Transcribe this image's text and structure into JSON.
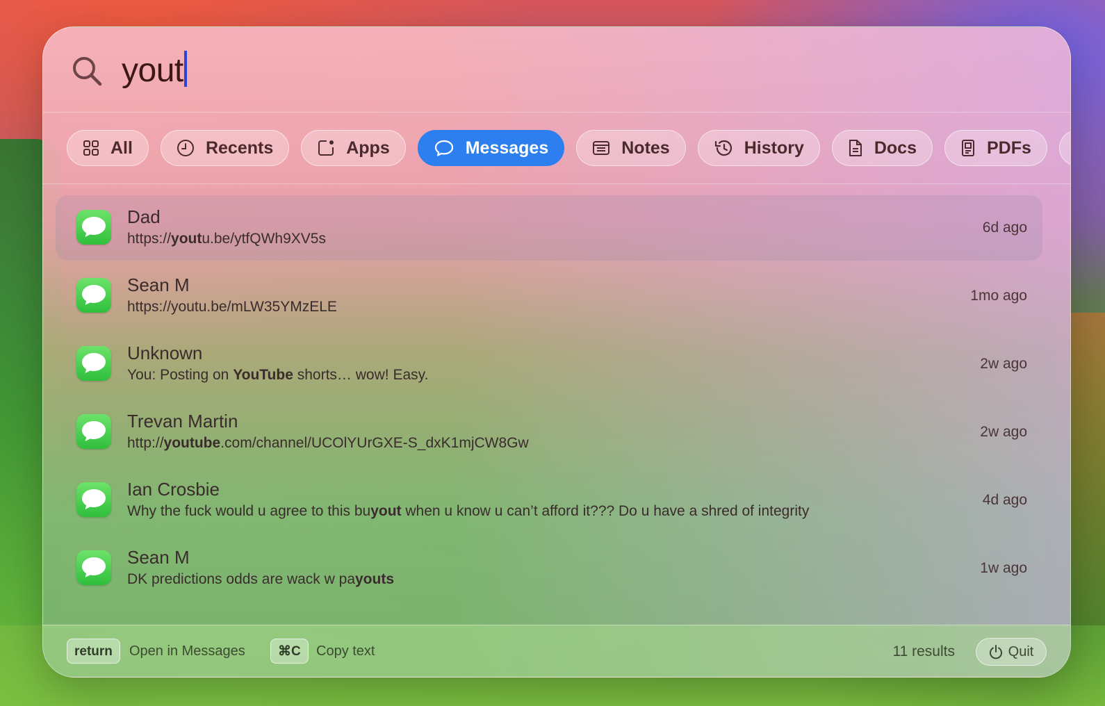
{
  "search": {
    "query": "yout",
    "icon": "search-icon"
  },
  "tabs": [
    {
      "label": "All",
      "icon": "grid-icon",
      "active": false
    },
    {
      "label": "Recents",
      "icon": "clock-icon",
      "active": false
    },
    {
      "label": "Apps",
      "icon": "app-icon",
      "active": false
    },
    {
      "label": "Messages",
      "icon": "speech-bubble-icon",
      "active": true
    },
    {
      "label": "Notes",
      "icon": "note-icon",
      "active": false
    },
    {
      "label": "History",
      "icon": "history-icon",
      "active": false
    },
    {
      "label": "Docs",
      "icon": "document-icon",
      "active": false
    },
    {
      "label": "PDFs",
      "icon": "pdf-icon",
      "active": false
    }
  ],
  "results": [
    {
      "name": "Dad",
      "segments": [
        [
          "https://",
          ""
        ],
        [
          "yout",
          "b"
        ],
        [
          "u.be/ytfQWh9XV5s",
          ""
        ]
      ],
      "time": "6d ago",
      "selected": true
    },
    {
      "name": "Sean M",
      "segments": [
        [
          "https://youtu.be/mLW35YMzELE",
          ""
        ]
      ],
      "time": "1mo ago",
      "selected": false
    },
    {
      "name": "Unknown",
      "segments": [
        [
          "You: Posting on ",
          ""
        ],
        [
          "YouTube",
          "b"
        ],
        [
          " shorts… wow! Easy.",
          ""
        ]
      ],
      "time": "2w ago",
      "selected": false
    },
    {
      "name": "Trevan Martin",
      "segments": [
        [
          "http://",
          ""
        ],
        [
          "youtube",
          "b"
        ],
        [
          ".com/channel/UCOlYUrGXE-S_dxK1mjCW8Gw",
          ""
        ]
      ],
      "time": "2w ago",
      "selected": false
    },
    {
      "name": "Ian Crosbie",
      "segments": [
        [
          "Why the fuck would u agree to this bu",
          ""
        ],
        [
          "yout",
          "b"
        ],
        [
          " when u know u can’t afford it??? Do u have a shred of integrity",
          ""
        ]
      ],
      "time": "4d ago",
      "selected": false
    },
    {
      "name": "Sean M",
      "segments": [
        [
          "DK predictions odds are wack w pa",
          ""
        ],
        [
          "youts",
          "b"
        ]
      ],
      "time": "1w ago",
      "selected": false
    }
  ],
  "footer": {
    "return_key": "return",
    "return_label": "Open in Messages",
    "copy_key": "⌘C",
    "copy_label": "Copy text",
    "result_count": "11 results",
    "quit_label": "Quit"
  },
  "colors": {
    "accent": "#2d7ff0",
    "messages_green": "#34c759"
  }
}
